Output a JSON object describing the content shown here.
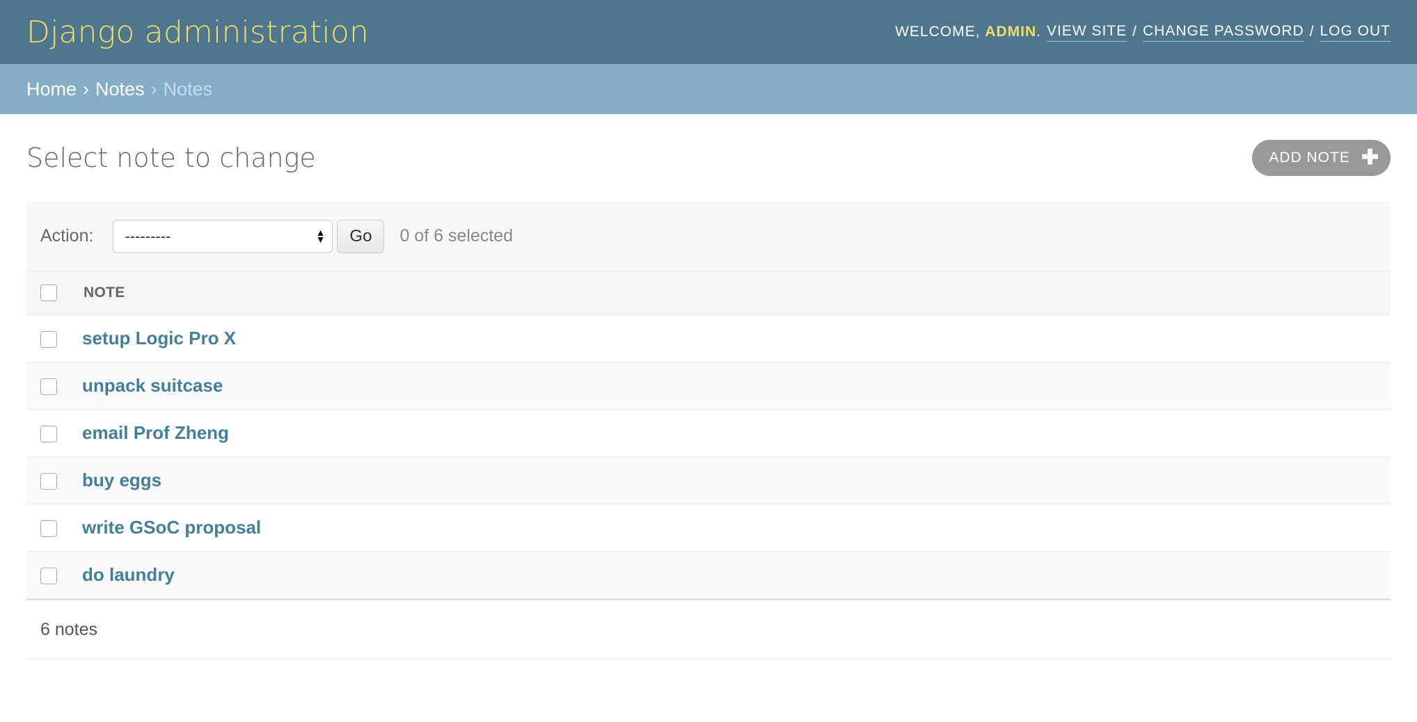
{
  "header": {
    "branding": "Django administration",
    "welcome": "Welcome,",
    "username": "admin",
    "username_suffix": ".",
    "view_site": "View site",
    "change_password": "Change password",
    "log_out": "Log out",
    "separator": "/"
  },
  "breadcrumbs": {
    "home": "Home",
    "app": "Notes",
    "current": "Notes",
    "separator": "›"
  },
  "main": {
    "title": "Select note to change",
    "add_button": "Add note",
    "add_icon": "plus-icon"
  },
  "actions": {
    "label": "Action:",
    "select_value": "---------",
    "go_label": "Go",
    "selected_text": "0 of 6 selected"
  },
  "table": {
    "header": "Note",
    "rows": [
      "setup Logic Pro X",
      "unpack suitcase",
      "email Prof Zheng",
      "buy eggs",
      "write GSoC proposal",
      "do laundry"
    ]
  },
  "paginator": {
    "count_text": "6 notes"
  },
  "colors": {
    "header_bg": "#4f768f",
    "breadcrumb_bg": "#84adc7",
    "branding": "#f5dd5d",
    "link": "#447e9b"
  }
}
